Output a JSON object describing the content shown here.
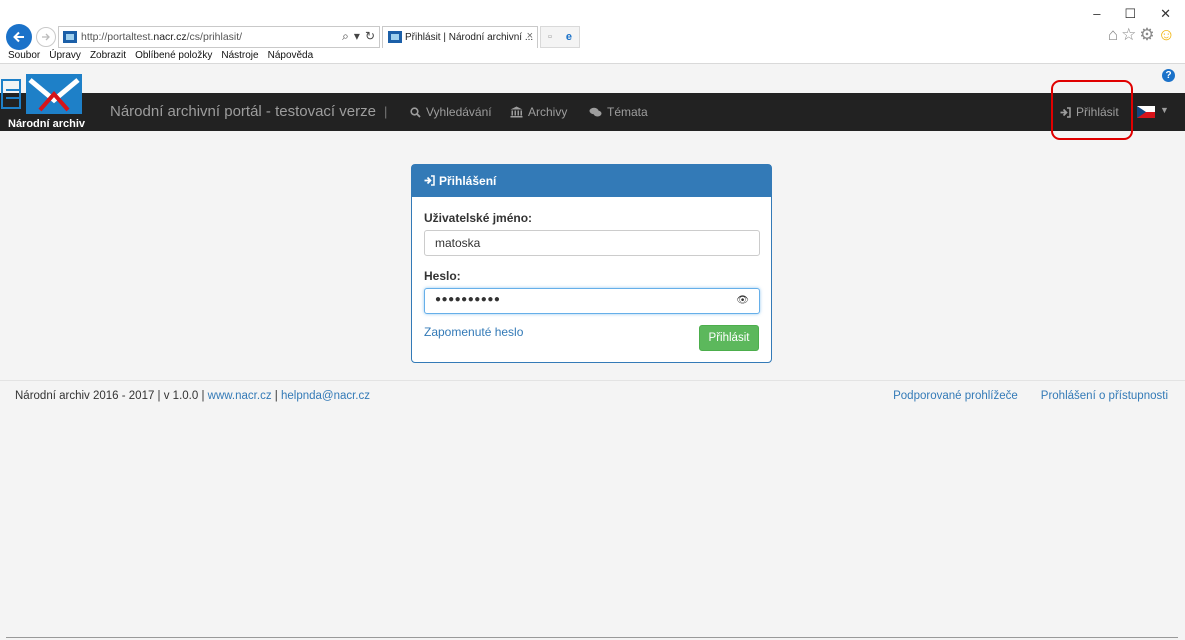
{
  "browser": {
    "url_prefix": "http://portaltest.",
    "url_domain": "nacr.cz",
    "url_suffix": "/cs/prihlasit/",
    "tab_title": "Přihlásit | Národní archivní ...",
    "menu": [
      "Soubor",
      "Úpravy",
      "Zobrazit",
      "Oblíbené položky",
      "Nástroje",
      "Nápověda"
    ]
  },
  "header": {
    "logo_label": "Národní archiv",
    "brand": "Národní archivní portál - testovací verze",
    "separator": "|",
    "nav": [
      {
        "label": "Vyhledávání",
        "icon": "search-icon"
      },
      {
        "label": "Archivy",
        "icon": "institution-icon"
      },
      {
        "label": "Témata",
        "icon": "comments-icon"
      }
    ],
    "login_label": "Přihlásit",
    "language": "cs"
  },
  "login": {
    "title": "Přihlášení",
    "username_label": "Uživatelské jméno:",
    "username_value": "matoska",
    "password_label": "Heslo:",
    "password_masked": "●●●●●●●●●●",
    "forgot_label": "Zapomenuté heslo",
    "submit_label": "Přihlásit"
  },
  "footer": {
    "text": "Národní archiv 2016 - 2017 | v 1.0.0 | ",
    "link1": "www.nacr.cz",
    "sep": " | ",
    "link2": "helpnda@nacr.cz",
    "right_links": [
      "Podporované prohlížeče",
      "Prohlášení o přístupnosti"
    ]
  },
  "colors": {
    "navbar": "#222222",
    "panel_primary": "#337ab7",
    "button_success": "#5cb85c",
    "highlight": "#e00000"
  }
}
